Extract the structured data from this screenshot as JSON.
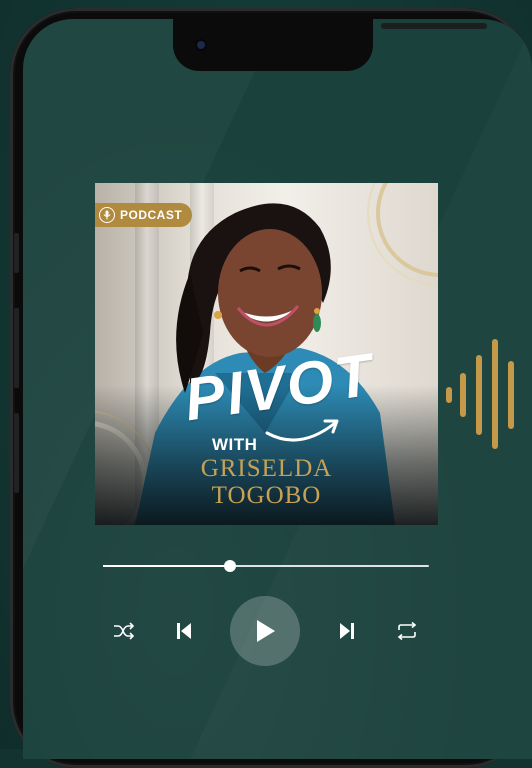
{
  "cover": {
    "badge_label": "PODCAST",
    "title": "PIVOT",
    "with_label": "WITH",
    "host_first_name": "GRISELDA",
    "host_last_name": "TOGOBO"
  },
  "player": {
    "progress": 0.39,
    "state": "paused",
    "controls": [
      "shuffle-icon",
      "previous-icon",
      "play-icon",
      "next-icon",
      "repeat-icon"
    ]
  },
  "colors": {
    "background": "#143a36",
    "gold": "#c7a254",
    "badge": "#b08a3e",
    "waveform": "#c49a4a"
  }
}
